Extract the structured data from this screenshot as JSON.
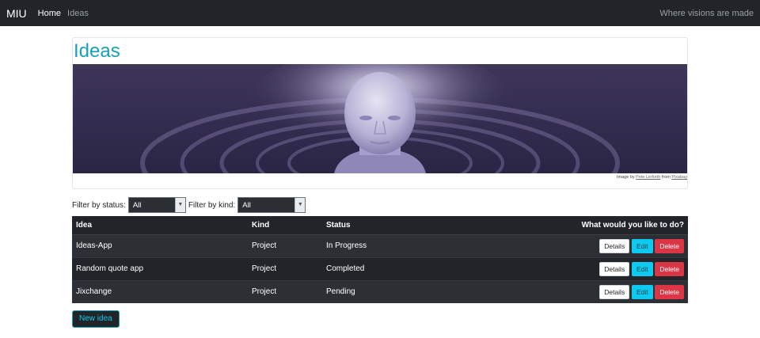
{
  "navbar": {
    "brand": "MIU",
    "links": [
      {
        "label": "Home",
        "active": true
      },
      {
        "label": "Ideas",
        "active": false
      }
    ],
    "tagline": "Where visions are made"
  },
  "card": {
    "title": "Ideas",
    "credit": {
      "prefix": "Image by ",
      "author": "Pete Linforth",
      "middle": " from ",
      "source": "Pixabay"
    }
  },
  "filters": {
    "status_label": "Filter by status:",
    "status_value": "All",
    "kind_label": "Filter by kind:",
    "kind_value": "All"
  },
  "table": {
    "headers": [
      "Idea",
      "Kind",
      "Status",
      "What would you like to do?"
    ],
    "rows": [
      {
        "idea": "Ideas-App",
        "kind": "Project",
        "status": "In Progress"
      },
      {
        "idea": "Random quote app",
        "kind": "Project",
        "status": "Completed"
      },
      {
        "idea": "Jixchange",
        "kind": "Project",
        "status": "Pending"
      }
    ],
    "actions": {
      "details": "Details",
      "edit": "Edit",
      "delete": "Delete"
    }
  },
  "new_idea_label": "New idea",
  "colors": {
    "navbar_bg": "#212529",
    "accent": "#17a2b8",
    "edit": "#0dcaf0",
    "delete": "#dc3545"
  }
}
